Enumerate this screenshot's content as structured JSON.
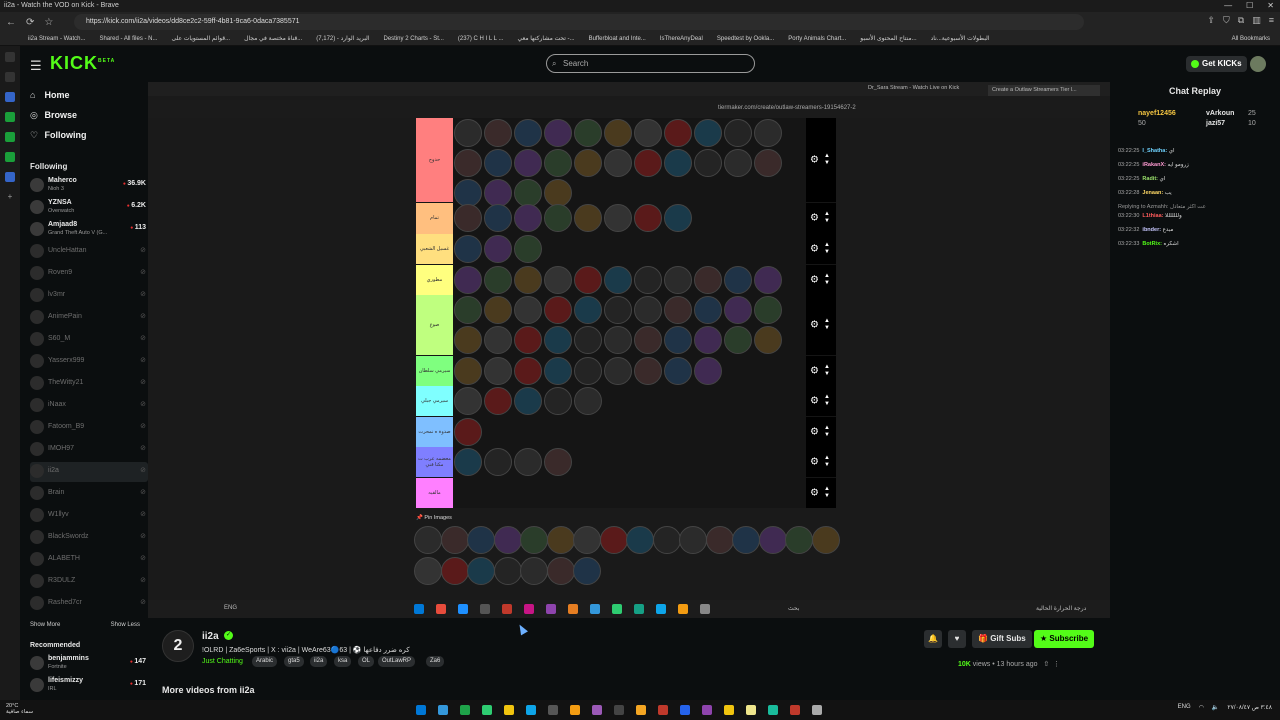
{
  "browser": {
    "window_title": "ii2a - Watch the VOD on Kick - Brave",
    "url": "https://kick.com/ii2a/videos/dd8ce2c2-59ff-4b81-9ca6-0daca7385571",
    "bookmarks": [
      "ii2a Stream - Watch...",
      "Shared - All files - N...",
      "قوائم المستويات على...",
      "قناة مختصة في مجال...",
      "البريد الوارد - (7,172)",
      "Destiny 2 Charts - St...",
      "(237) C H I L L ...",
      "تحت مشاركتها معي -...",
      "Bufferbloat and Inte...",
      "IsThereAnyDeal",
      "Speedtest by Ookla...",
      "Porty Animals Chart...",
      "منتاح المحتوى الأسبو...",
      "البطولات الأسبوعية...ناد"
    ],
    "all_bookmarks": "All Bookmarks"
  },
  "kick": {
    "logo": "KICK",
    "logo_sup": "BETA",
    "search_placeholder": "Search",
    "get_kicks": "Get KICKs"
  },
  "sidebar": {
    "nav": [
      {
        "label": "Home",
        "icon": "home-icon"
      },
      {
        "label": "Browse",
        "icon": "compass-icon"
      },
      {
        "label": "Following",
        "icon": "heart-icon"
      }
    ],
    "following_header": "Following",
    "live": [
      {
        "name": "Maherco",
        "game": "Nioh 3",
        "viewers": "36.9K"
      },
      {
        "name": "YZNSA",
        "game": "Overwatch",
        "viewers": "6.2K"
      },
      {
        "name": "Amjaad8",
        "game": "Grand Theft Auto V (G...",
        "viewers": "113"
      }
    ],
    "offline": [
      "UncleHattan",
      "Roven9",
      "lv3mr",
      "AnimePain",
      "S60_M",
      "Yasserx999",
      "TheWitty21",
      "iNaax",
      "Fatoom_B9",
      "IMOH97",
      "ii2a",
      "Brain",
      "W1llyv",
      "BlackSwordz",
      "ALABETH",
      "R3DULZ",
      "Rashed7cr"
    ],
    "show_more": "Show More",
    "show_less": "Show Less",
    "recommended_header": "Recommended",
    "recommended": [
      {
        "name": "benjammins",
        "game": "Fortnite",
        "viewers": "147"
      },
      {
        "name": "lifeismizzy",
        "game": "IRL",
        "viewers": "171"
      }
    ]
  },
  "video": {
    "tab_inactive": "Dr_Sara Stream - Watch Live on Kick",
    "tab_active": "Create a Outlaw Streamers Tier l...",
    "inner_url": "tiermaker.com/create/outlaw-streamers-19154627-2",
    "tier_labels": [
      "حدوج",
      "تمام",
      "غسيل الشعبي",
      "مطوري",
      "صوع",
      "سيرمي سلطان",
      "سيرمي جبلي",
      "صدوة ه نمحرت",
      "معضمه عرب ت مكتا فني",
      "مالقيه"
    ],
    "tier_colors": [
      "#ff7f7f",
      "#ffbf7f",
      "#ffdf7f",
      "#ffff7f",
      "#bfff7f",
      "#7fff7f",
      "#7fffff",
      "#7fbfff",
      "#7f7fff",
      "#ff7fff"
    ],
    "pin_header": "Pin Images",
    "lang": "ENG",
    "taskbar_search": "بحث",
    "tray_text": "درجة الحرارة الحالية"
  },
  "chat": {
    "title": "Chat Replay",
    "top_supporters": [
      {
        "name": "nayef12456",
        "count": "50"
      },
      {
        "name": "vArkoun",
        "count": "25"
      },
      {
        "name": "jazi57",
        "count": "10"
      }
    ],
    "messages": [
      {
        "time": "03:22:25",
        "user": "I_Shatha:",
        "text": "اي"
      },
      {
        "time": "03:22:25",
        "user": "iRakanX:",
        "text": "زرومو ايه"
      },
      {
        "time": "03:22:25",
        "user": "Radit:",
        "text": "اي"
      },
      {
        "time": "03:22:28",
        "user": "Jenaan:",
        "text": "يب"
      },
      {
        "time": "",
        "user": "Replying to Azmahh:",
        "text": "عت اكثر متعادل"
      },
      {
        "time": "03:22:30",
        "user": "L1thiaa:",
        "text": "ولللللللا"
      },
      {
        "time": "03:22:32",
        "user": "ibnder:",
        "text": "مبدع"
      },
      {
        "time": "03:22:33",
        "user": "BotRix:",
        "text": "اشكره"
      }
    ]
  },
  "stream": {
    "channel_avatar": "2",
    "channel": "ii2a",
    "title": "!OLRD | Za6eSports | X : vii2a | WeAre63🔵63 | ⚽ كره ضرر دفاعها",
    "category": "Just Chatting",
    "tags": [
      "Arabic",
      "gta5",
      "ii2a",
      "ksa",
      "OL",
      "OutLawRP",
      "Za6"
    ],
    "gift_subs": "Gift Subs",
    "subscribe": "Subscribe",
    "views": "10K",
    "views_label": "views",
    "ago": "13 hours ago",
    "more_videos": "More videos from ii2a"
  },
  "taskbar": {
    "weather_temp": "20°C",
    "weather_desc": "سماء صافية",
    "lang": "ENG",
    "time": "٣:٤٨ ص",
    "date": "٢٧/٠٨/٤٧"
  }
}
